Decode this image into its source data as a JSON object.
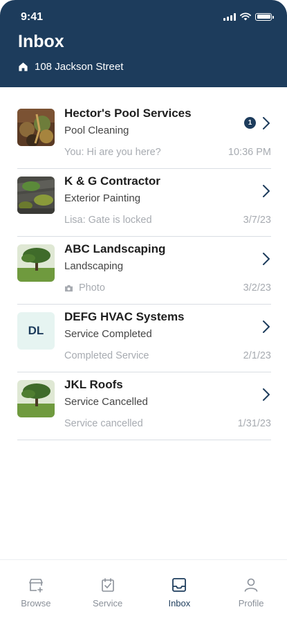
{
  "status_bar": {
    "time": "9:41"
  },
  "header": {
    "title": "Inbox",
    "address": "108 Jackson Street",
    "background": "#1d3c5c"
  },
  "conversations": [
    {
      "name": "Hector's Pool Services",
      "service": "Pool Cleaning",
      "preview": "You: Hi are you here?",
      "time": "10:36 PM",
      "unread": "1",
      "thumb": "pool-photo"
    },
    {
      "name": "K & G Contractor",
      "service": "Exterior Painting",
      "preview": "Lisa: Gate is locked",
      "time": "3/7/23",
      "thumb": "roof-photo"
    },
    {
      "name": "ABC Landscaping",
      "service": "Landscaping",
      "preview": "Photo",
      "time": "3/2/23",
      "thumb": "tree-photo"
    },
    {
      "name": "DEFG HVAC Systems",
      "service": "Service Completed",
      "preview": "Completed Service",
      "time": "2/1/23",
      "initials": "DL"
    },
    {
      "name": "JKL Roofs",
      "service": "Service Cancelled",
      "preview": "Service cancelled",
      "time": "1/31/23",
      "thumb": "tree-photo"
    }
  ],
  "tabs": [
    {
      "label": "Browse",
      "icon": "browse-icon",
      "active": false
    },
    {
      "label": "Service",
      "icon": "service-icon",
      "active": false
    },
    {
      "label": "Inbox",
      "icon": "inbox-icon",
      "active": true
    },
    {
      "label": "Profile",
      "icon": "profile-icon",
      "active": false
    }
  ]
}
